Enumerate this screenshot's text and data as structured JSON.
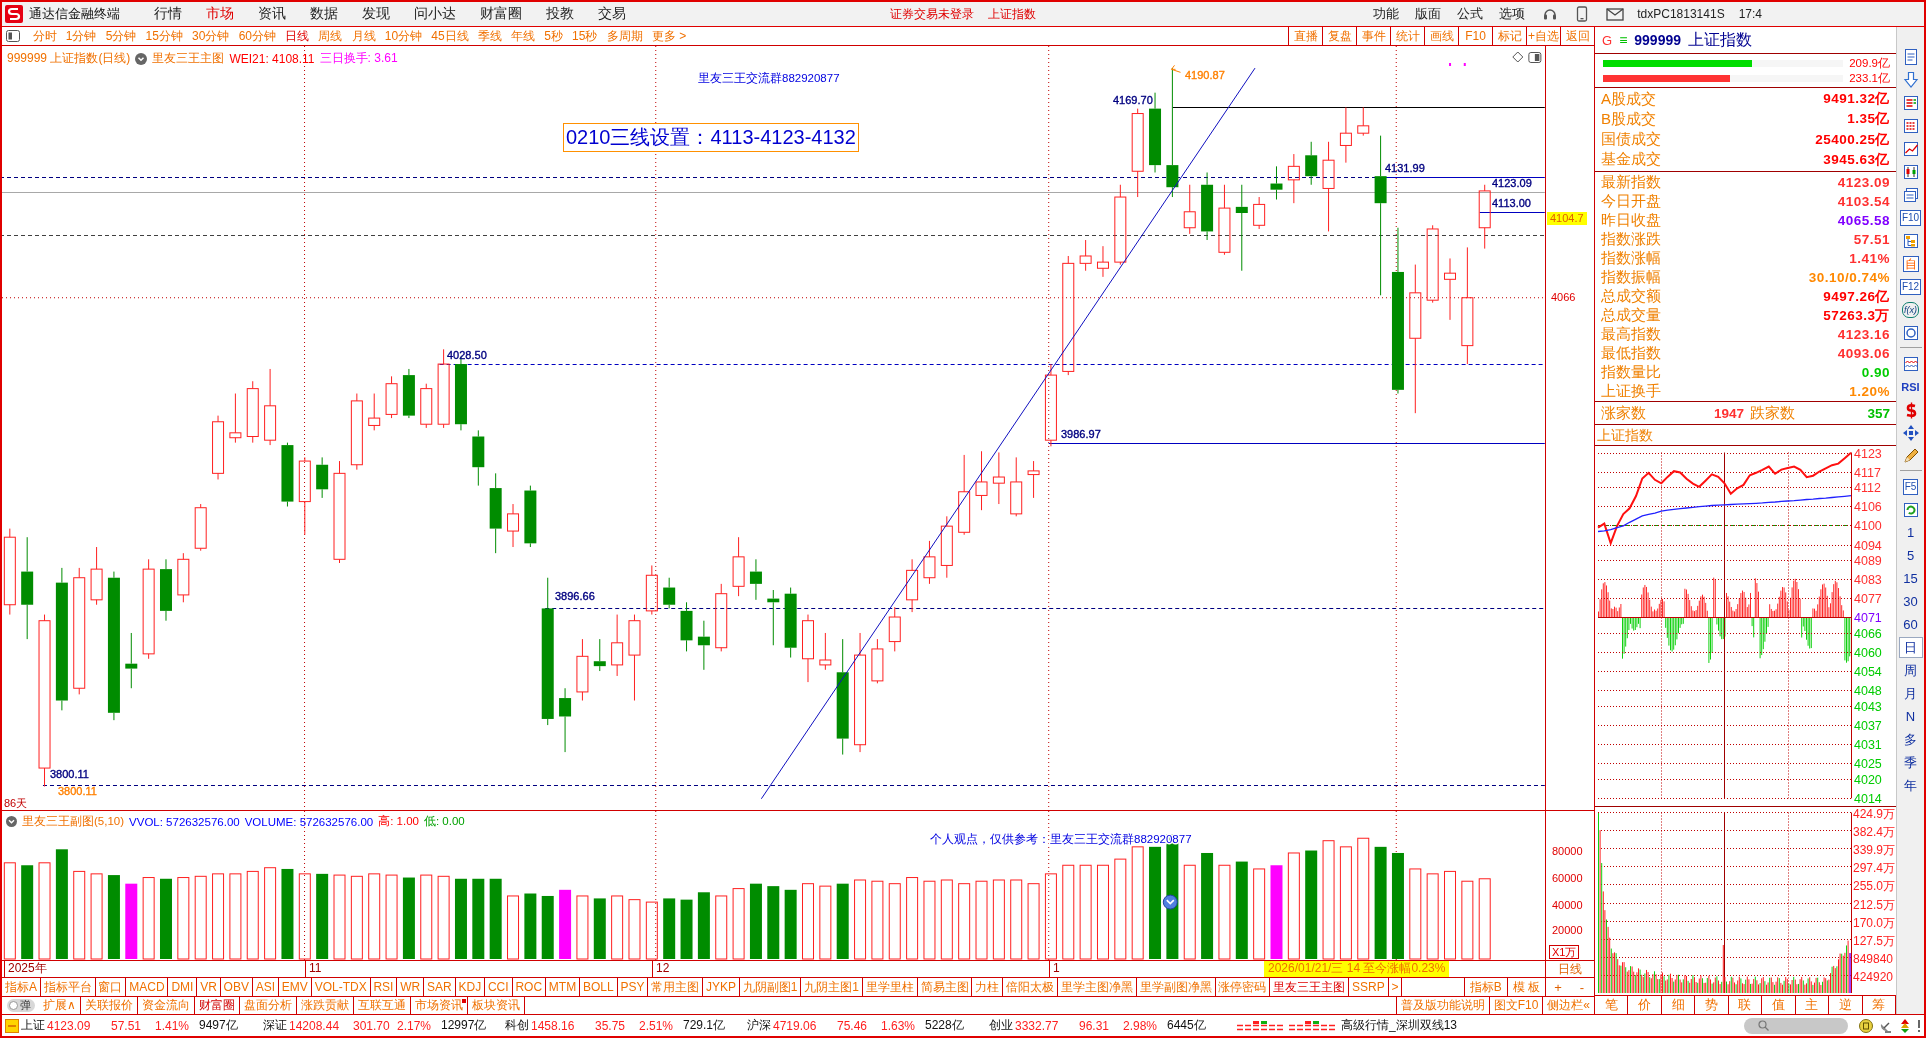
{
  "menu_bar": {
    "app_title": "通达信金融终端",
    "menus": [
      {
        "label": "行情",
        "selected": false
      },
      {
        "label": "市场",
        "selected": true
      },
      {
        "label": "资讯",
        "selected": false
      },
      {
        "label": "数据",
        "selected": false
      },
      {
        "label": "发现",
        "selected": false
      },
      {
        "label": "问小达",
        "selected": false
      },
      {
        "label": "财富圈",
        "selected": false
      },
      {
        "label": "投教",
        "selected": false
      },
      {
        "label": "交易",
        "selected": false
      }
    ],
    "login_notice": "证券交易未登录",
    "index_link": "上证指数",
    "tools": [
      "功能",
      "版面",
      "公式",
      "选项"
    ],
    "account": "tdxPC1813141S",
    "time": "17:4"
  },
  "period_bar": {
    "periods": [
      {
        "label": "分时",
        "selected": false
      },
      {
        "label": "1分钟",
        "selected": false
      },
      {
        "label": "5分钟",
        "selected": false
      },
      {
        "label": "15分钟",
        "selected": false
      },
      {
        "label": "30分钟",
        "selected": false
      },
      {
        "label": "60分钟",
        "selected": false
      },
      {
        "label": "日线",
        "selected": true
      },
      {
        "label": "周线",
        "selected": false
      },
      {
        "label": "月线",
        "selected": false
      },
      {
        "label": "10分钟",
        "selected": false
      },
      {
        "label": "45日线",
        "selected": false
      },
      {
        "label": "季线",
        "selected": false
      },
      {
        "label": "年线",
        "selected": false
      },
      {
        "label": "5秒",
        "selected": false
      },
      {
        "label": "15秒",
        "selected": false
      },
      {
        "label": "多周期",
        "selected": false
      }
    ],
    "more": "更多 >",
    "actions": [
      "直播",
      "复盘",
      "事件",
      "统计",
      "画线",
      "F10",
      "标记",
      "+自选",
      "返回"
    ]
  },
  "main_chart": {
    "series_title": "999999 上证指数(日线)",
    "template": "里友三王主图",
    "readouts": [
      {
        "text": "WEI21: 4108.11",
        "color": "#ff0000"
      },
      {
        "text": "三日换手: 3.61",
        "color": "#ff00ff"
      }
    ],
    "group_note": "里友三王交流群882920877",
    "setting_note": "0210三线设置：4113-4123-4132",
    "price_labels": [
      {
        "text": "4190.87",
        "color": "#ff8000"
      },
      {
        "text": "4169.70",
        "color": "#000080"
      },
      {
        "text": "4131.99",
        "color": "#000080"
      },
      {
        "text": "4123.09",
        "color": "#000080"
      },
      {
        "text": "4113.00",
        "color": "#000080"
      },
      {
        "text": "4028.50",
        "color": "#000080"
      },
      {
        "text": "3986.97",
        "color": "#000080"
      },
      {
        "text": "3896.66",
        "color": "#000080"
      },
      {
        "text": "3800.11",
        "color": "#000080"
      },
      {
        "text": "3800.11",
        "color": "#ff8000"
      }
    ],
    "day_count": "86天",
    "axis_label": "4066",
    "cursor_price": "4104.7"
  },
  "volume_pane": {
    "title": "里友三王副图(5,10)",
    "readouts": [
      {
        "text": "VVOL: 572632576.00",
        "color": "#0000ff"
      },
      {
        "text": "VOLUME: 572632576.00",
        "color": "#0000ff"
      },
      {
        "text": "高: 1.00",
        "color": "#ff0000"
      },
      {
        "text": "低: 0.00",
        "color": "#00a000"
      }
    ],
    "note": "个人观点，仅供参考：里友三王交流群882920877",
    "axis_labels": [
      "80000",
      "60000",
      "40000",
      "20000"
    ],
    "unit": "X1万"
  },
  "date_axis": {
    "labels": [
      "2025年",
      "11",
      "12",
      "1"
    ],
    "cursor_date": "2026/01/21/三 14 至今涨幅0.23%",
    "period": "日线"
  },
  "indicator_tabs": [
    {
      "label": "指标A",
      "selected": false
    },
    {
      "label": "指标平台",
      "selected": false
    },
    {
      "label": "窗口",
      "selected": false
    },
    {
      "label": "MACD",
      "selected": false
    },
    {
      "label": "DMI",
      "selected": false
    },
    {
      "label": "VR",
      "selected": false
    },
    {
      "label": "OBV",
      "selected": false
    },
    {
      "label": "ASI",
      "selected": false
    },
    {
      "label": "EMV",
      "selected": false
    },
    {
      "label": "VOL-TDX",
      "selected": false
    },
    {
      "label": "RSI",
      "selected": false
    },
    {
      "label": "WR",
      "selected": false
    },
    {
      "label": "SAR",
      "selected": false
    },
    {
      "label": "KDJ",
      "selected": false
    },
    {
      "label": "CCI",
      "selected": false
    },
    {
      "label": "ROC",
      "selected": false
    },
    {
      "label": "MTM",
      "selected": false
    },
    {
      "label": "BOLL",
      "selected": false
    },
    {
      "label": "PSY",
      "selected": false
    },
    {
      "label": "常用主图",
      "selected": false
    },
    {
      "label": "JYKP",
      "selected": false
    },
    {
      "label": "九阴副图1",
      "selected": false
    },
    {
      "label": "九阴主图1",
      "selected": false
    },
    {
      "label": "里学里柱",
      "selected": false
    },
    {
      "label": "简易主图",
      "selected": false
    },
    {
      "label": "力柱",
      "selected": false
    },
    {
      "label": "倍阳太极",
      "selected": false
    },
    {
      "label": "里学主图净黑",
      "selected": false
    },
    {
      "label": "里学副图净黑",
      "selected": false
    },
    {
      "label": "涨停密码",
      "selected": false
    },
    {
      "label": "里友三王主图",
      "selected": true
    },
    {
      "label": "SSRP",
      "selected": false
    },
    {
      "label": ">",
      "selected": false
    }
  ],
  "indicator_buttons": [
    "指标B",
    "模 板"
  ],
  "zoom_buttons": [
    "+",
    "-"
  ],
  "info_tabs": {
    "toggle": {
      "label": "弹",
      "on": false
    },
    "tabs": [
      {
        "label": "扩展∧",
        "selected": false,
        "flagged": false
      },
      {
        "label": "关联报价",
        "selected": false,
        "flagged": false
      },
      {
        "label": "资金流向",
        "selected": false,
        "flagged": false
      },
      {
        "label": "财富圈",
        "selected": true,
        "flagged": false
      },
      {
        "label": "盘面分析",
        "selected": false,
        "flagged": false
      },
      {
        "label": "涨跌贡献",
        "selected": false,
        "flagged": false
      },
      {
        "label": "互联互通",
        "selected": false,
        "flagged": false
      },
      {
        "label": "市场资讯",
        "selected": false,
        "flagged": true
      },
      {
        "label": "板块资讯",
        "selected": false,
        "flagged": false
      }
    ],
    "links": [
      "普及版功能说明",
      "图文F10",
      "侧边栏«"
    ]
  },
  "quote_panel": {
    "marker": "G",
    "menu_glyph": "≡",
    "code": "999999",
    "name": "上证指数",
    "flow_bars": [
      {
        "value": "209.9亿",
        "level": 0.62,
        "color": "#00dd00"
      },
      {
        "value": "233.1亿",
        "level": 0.53,
        "color": "#ff3333"
      }
    ],
    "turnover": [
      {
        "label": "A股成交",
        "value": "9491.32亿",
        "color": "#ff0000"
      },
      {
        "label": "B股成交",
        "value": "1.35亿",
        "color": "#ff0000"
      },
      {
        "label": "国债成交",
        "value": "25400.25亿",
        "color": "#ff0000"
      },
      {
        "label": "基金成交",
        "value": "3945.63亿",
        "color": "#ff0000"
      }
    ],
    "index_stats": [
      {
        "label": "最新指数",
        "value": "4123.09",
        "color": "#ff3030"
      },
      {
        "label": "今日开盘",
        "value": "4103.54",
        "color": "#ff3030"
      },
      {
        "label": "昨日收盘",
        "value": "4065.58",
        "color": "#8000ff"
      },
      {
        "label": "指数涨跌",
        "value": "57.51",
        "color": "#ff3030"
      },
      {
        "label": "指数涨幅",
        "value": "1.41%",
        "color": "#ff3030"
      },
      {
        "label": "指数振幅",
        "value": "30.10/0.74%",
        "color": "#ff8800"
      },
      {
        "label": "总成交额",
        "value": "9497.26亿",
        "color": "#ff0000"
      },
      {
        "label": "总成交量",
        "value": "57263.3万",
        "color": "#ff0000"
      },
      {
        "label": "最高指数",
        "value": "4123.16",
        "color": "#ff3030"
      },
      {
        "label": "最低指数",
        "value": "4093.06",
        "color": "#ff3030"
      },
      {
        "label": "指数量比",
        "value": "0.90",
        "color": "#00cc00"
      },
      {
        "label": "上证换手",
        "value": "1.20%",
        "color": "#ff8800"
      }
    ],
    "breadth": {
      "up_label": "涨家数",
      "up_count": "1947",
      "down_label": "跌家数",
      "down_count": "357"
    },
    "intraday": {
      "title": "上证指数",
      "chart_data": {
        "type": "line",
        "series": [
          {
            "color": "#ff1010",
            "values": [
              4099.3,
              4100.6,
              4094.4,
              4099.8,
              4103.6,
              4105.4,
              4109.3,
              4114.8,
              4116.6,
              4114.4,
              4113.3,
              4115.3,
              4117.1,
              4116.7,
              4114.7,
              4113.2,
              4112.2,
              4114.1,
              4116.1,
              4115.3,
              4113.3,
              4110.0,
              4111.7,
              4112.8,
              4115.8,
              4116.6,
              4117.5,
              4118.6,
              4116.3,
              4117.6,
              4118.1,
              4118.6,
              4117.5,
              4115.2,
              4115.7,
              4117.0,
              4118.0,
              4119.0,
              4119.5,
              4121.2,
              4122.9
            ]
          },
          {
            "color": "#2020ff",
            "values": [
              4098.1,
              4098.3,
              4098.7,
              4099.3,
              4099.9,
              4101.0,
              4102.0,
              4103.0,
              4103.5,
              4103.9,
              4104.5,
              4104.8,
              4105.1,
              4105.3,
              4105.5,
              4105.7,
              4105.9,
              4106.1,
              4106.3,
              4106.4,
              4106.5,
              4106.6,
              4106.7,
              4106.8,
              4106.9,
              4107.0,
              4107.1,
              4107.3,
              4107.4,
              4107.6,
              4107.7,
              4107.8,
              4108.0,
              4108.2,
              4108.3,
              4108.5,
              4108.6,
              4108.8,
              4109.0,
              4109.2,
              4109.4
            ]
          }
        ],
        "ylim": [
          4014,
          4123
        ],
        "yticks": [
          4123,
          4117,
          4112,
          4106,
          4100,
          4094,
          4089,
          4083,
          4077,
          4071,
          4066,
          4060,
          4054,
          4048,
          4043,
          4037,
          4031,
          4025,
          4020,
          4014
        ],
        "grid": true
      },
      "volume_ticks": [
        "424.9万",
        "382.4万",
        "339.9万",
        "297.4万",
        "255.0万",
        "212.5万",
        "170.0万",
        "127.5万",
        "849840",
        "424920"
      ]
    },
    "tabs": [
      "笔",
      "价",
      "细",
      "势",
      "联",
      "值",
      "主",
      "逆",
      "筹"
    ]
  },
  "sidebar": {
    "icon_labels": [
      "F10",
      "自",
      "F12",
      "f(x)",
      "RSI",
      "F5"
    ],
    "periods": [
      {
        "label": "1",
        "selected": false
      },
      {
        "label": "5",
        "selected": false
      },
      {
        "label": "15",
        "selected": false
      },
      {
        "label": "30",
        "selected": false
      },
      {
        "label": "60",
        "selected": false
      },
      {
        "label": "日",
        "selected": true
      },
      {
        "label": "周",
        "selected": false
      },
      {
        "label": "月",
        "selected": false
      },
      {
        "label": "N",
        "selected": false
      },
      {
        "label": "多",
        "selected": false
      },
      {
        "label": "季",
        "selected": false
      },
      {
        "label": "年",
        "selected": false
      }
    ]
  },
  "status_bar": {
    "markets": [
      {
        "name": "上证",
        "value": "4123.09",
        "change": "57.51",
        "percent": "1.41%",
        "amount": "9497亿"
      },
      {
        "name": "深证",
        "value": "14208.44",
        "change": "301.70",
        "percent": "2.17%",
        "amount": "12997亿"
      },
      {
        "name": "科创",
        "value": "1458.16",
        "change": "35.75",
        "percent": "2.51%",
        "amount": "729.1亿"
      },
      {
        "name": "沪深",
        "value": "4719.06",
        "change": "75.46",
        "percent": "1.63%",
        "amount": "5228亿"
      },
      {
        "name": "创业",
        "value": "3332.77",
        "change": "96.31",
        "percent": "2.98%",
        "amount": "6445亿"
      }
    ],
    "feed": "高级行情_深圳双线13"
  }
}
